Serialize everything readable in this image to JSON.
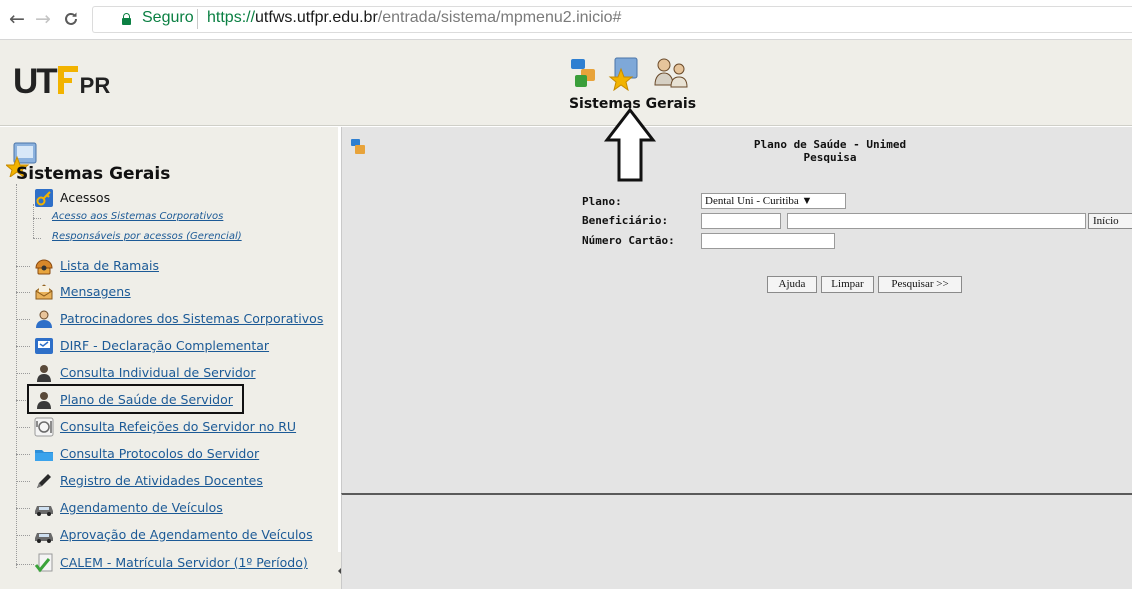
{
  "browser": {
    "secure_label": "Seguro",
    "url_proto": "https://",
    "url_host": "utfws.utfpr.edu.br",
    "url_path": "/entrada/sistema/mpmenu2.inicio#",
    "nav": {
      "back": "←",
      "forward": "→",
      "reload": "C"
    }
  },
  "header": {
    "logo_ut": "UT",
    "logo_pr": "PR",
    "title": "Sistemas Gerais"
  },
  "sidebar": {
    "title": "Sistemas Gerais",
    "group": {
      "label": "Acessos",
      "links": [
        "Acesso aos Sistemas Corporativos",
        "Responsáveis por acessos (Gerencial)"
      ]
    },
    "items": [
      {
        "label": "Lista de Ramais",
        "icon": "phone-icon"
      },
      {
        "label": "Mensagens",
        "icon": "mail-icon"
      },
      {
        "label": "Patrocinadores dos Sistemas Corporativos",
        "icon": "sponsor-icon"
      },
      {
        "label": "DIRF - Declaração Complementar",
        "icon": "tax-form-icon"
      },
      {
        "label": "Consulta Individual de Servidor",
        "icon": "person-icon"
      },
      {
        "label": "Plano de Saúde de Servidor",
        "icon": "person-icon"
      },
      {
        "label": "Consulta Refeições do Servidor no RU",
        "icon": "meal-icon"
      },
      {
        "label": "Consulta Protocolos do Servidor",
        "icon": "folder-icon"
      },
      {
        "label": "Registro de Atividades Docentes",
        "icon": "pen-icon"
      },
      {
        "label": "Agendamento de Veículos",
        "icon": "car-icon"
      },
      {
        "label": "Aprovação de Agendamento de Veículos",
        "icon": "car-icon"
      },
      {
        "label": "CALEM - Matrícula Servidor (1º Período)",
        "icon": "check-document-icon"
      }
    ]
  },
  "main": {
    "title_line1": "Plano de Saúde - Unimed",
    "title_line2": "Pesquisa",
    "form": {
      "plano_label": "Plano:",
      "plano_value": "Dental Uni - Curitiba ▼",
      "beneficiario_label": "Beneficiário:",
      "beneficiario_code": "",
      "beneficiario_name": "",
      "inicio_label": "Início",
      "numero_label": "Número Cartão:",
      "numero_value": ""
    },
    "buttons": {
      "ajuda": "Ajuda",
      "limpar": "Limpar",
      "pesquisar": "Pesquisar >>"
    }
  },
  "colors": {
    "secure_green": "#0b8043",
    "link_blue": "#1c5a96",
    "logo_yellow": "#f2b300",
    "header_bg": "#efeee8",
    "panel_bg": "#e4e4e4"
  }
}
